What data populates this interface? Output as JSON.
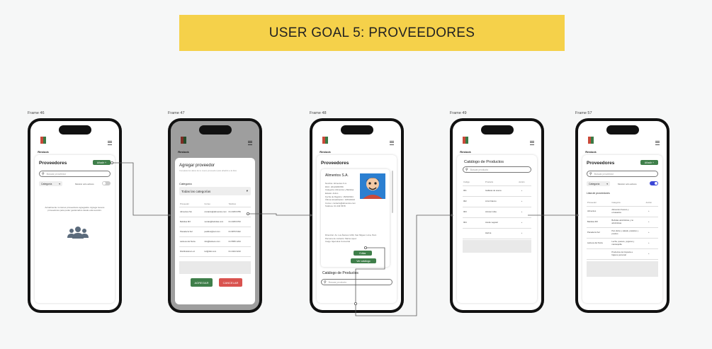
{
  "banner": {
    "title": "USER GOAL 5: PROVEEDORES"
  },
  "frames": [
    {
      "label": "Frame 46"
    },
    {
      "label": "Frame 47"
    },
    {
      "label": "Frame 48"
    },
    {
      "label": "Frame 49"
    },
    {
      "label": "Frame 57"
    }
  ],
  "app": {
    "logo_text": "Restock"
  },
  "f46": {
    "title": "Proveedores",
    "add_button": "Añadir +",
    "search_placeholder": "Buscar proveedor",
    "category_select": "Categoría",
    "toggle_label": "Mostrar sólo activos",
    "empty_text": "Actualmente no tienes proveedores agregados. Agrega nuevos proveedores para poder gestionarlos desde esta sección."
  },
  "f47": {
    "title": "Agregar proveedor",
    "subtitle": "Completa los datos de tu nuevo proveedor para añadirlo a la lista",
    "category_label": "Categoría",
    "category_value": "Todas las categorías",
    "columns": [
      "Proveedor",
      "Correo",
      "Teléfono"
    ],
    "rows": [
      [
        "Alimentos SA",
        "contacto@alimentos.com",
        "01 2345 6789"
      ],
      [
        "Bebidas MX",
        "ventas@bebidas.com",
        "01 2345 6700"
      ],
      [
        "Panadería Sol",
        "pedidos@sol.com",
        "01 9876 5432"
      ],
      [
        "Lácteos del Norte",
        "info@lacteos.com",
        "01 5555 1234"
      ],
      [
        "Distribuidora Luz",
        "luz@dist.com",
        "01 4444 3210"
      ]
    ],
    "save_button": "AGREGAR",
    "cancel_button": "CANCELAR"
  },
  "f48": {
    "title": "Proveedores",
    "supplier_name": "Alimentos S.A.",
    "details": [
      "Nombre: Alimentos S.A.",
      "RUC: 20123456789",
      "Categoría: Alimentos y Bebidas",
      "Estado: Activo",
      "Fecha de Registro: 15/03/2024",
      "Última Actualización: 10/04/2024",
      "Correo: contacto@alimentos.com",
      "Teléfono: 01 234 5678",
      "Dirección: Av. Los Álamos 1234, San Miguel, Lima, Perú",
      "Persona de contacto: María López",
      "Cargo: Ejecutiva Comercial"
    ],
    "edit_button": "Editar",
    "catalog_button": "Ver catálogo",
    "catalog_title": "Catálogo de Productos",
    "catalog_search": "Buscar producto"
  },
  "f49": {
    "title": "Catálogo de Productos",
    "search_placeholder": "Buscar producto",
    "columns": [
      "Código",
      "Producto",
      "Acción"
    ],
    "rows": [
      [
        "001",
        "Galletas de avena"
      ],
      [
        "002",
        "Arroz blanco"
      ],
      [
        "003",
        "Azúcar rubia"
      ],
      [
        "004",
        "Aceite vegetal"
      ],
      [
        "",
        "Harina"
      ]
    ]
  },
  "f57": {
    "title": "Proveedores",
    "add_button": "Añadir +",
    "search_placeholder": "Buscar proveedor",
    "category_select": "Categoría",
    "toggle_label": "Mostrar sólo activos",
    "list_title": "Lista de proveedores",
    "columns": [
      "Proveedor",
      "Categoría",
      "Acción"
    ],
    "rows": [
      [
        "Alimentos",
        "Alimentos frescos y envasados"
      ],
      [
        "Bebidas MX",
        "Bebidas alcohólicas y no alcohólicas"
      ],
      [
        "Panadería Sol",
        "Pan dulce y salado, pasteles y postres"
      ],
      [
        "Lácteos del Norte",
        "Leche, quesos, yogures y mantequilla"
      ],
      [
        "",
        "Productos de limpieza e higiene personal"
      ]
    ]
  },
  "colors": {
    "banner": "#f5d14a",
    "accent_green": "#3f7f4a",
    "danger_red": "#d9534f",
    "toggle_blue": "#3b46d6"
  }
}
